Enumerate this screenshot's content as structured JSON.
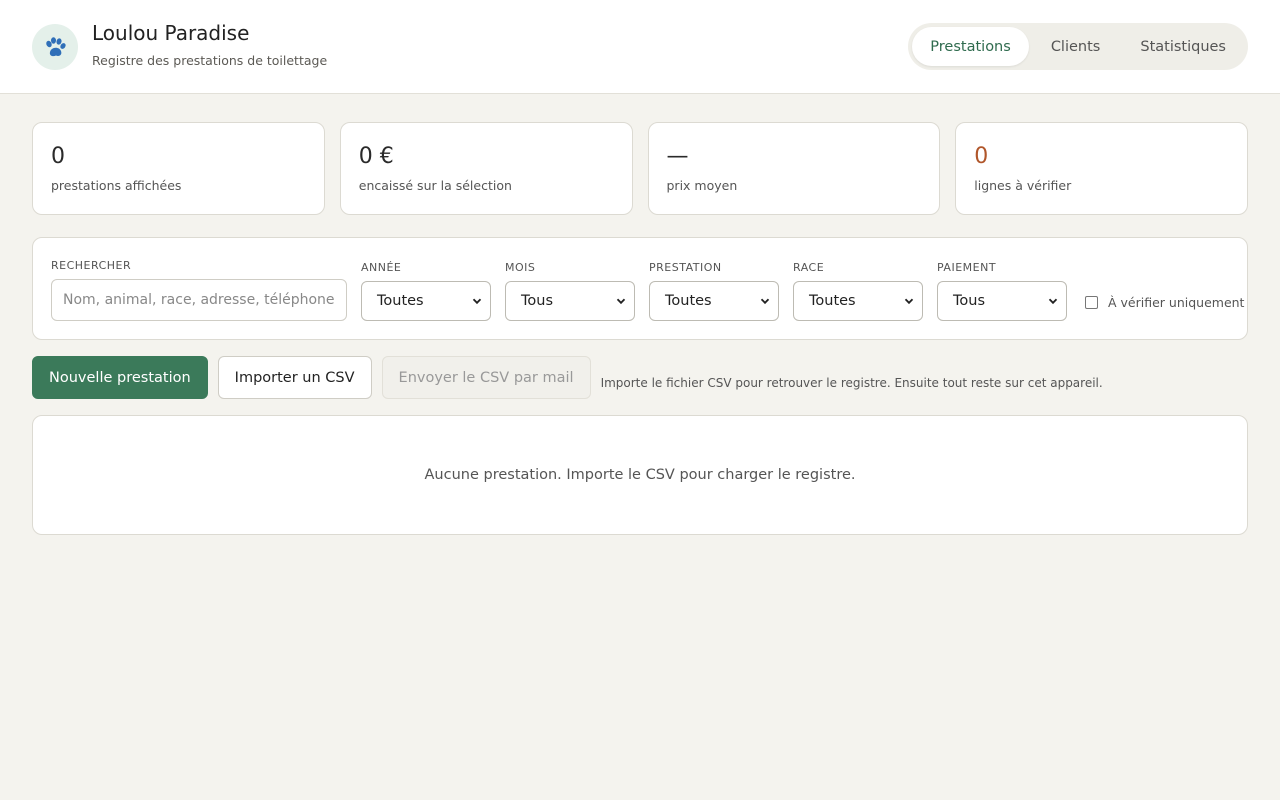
{
  "header": {
    "title": "Loulou Paradise",
    "subtitle": "Registre des prestations de toilettage",
    "logo_icon": "paw-icon",
    "tabs": [
      {
        "label": "Prestations",
        "active": true
      },
      {
        "label": "Clients",
        "active": false
      },
      {
        "label": "Statistiques",
        "active": false
      }
    ]
  },
  "stats": [
    {
      "value": "0",
      "label": "prestations affichées"
    },
    {
      "value": "0 €",
      "label": "encaissé sur la sélection"
    },
    {
      "value": "—",
      "label": "prix moyen"
    },
    {
      "value": "0",
      "label": "lignes à vérifier"
    }
  ],
  "filters": {
    "search": {
      "label": "RECHERCHER",
      "placeholder": "Nom, animal, race, adresse, téléphone",
      "value": ""
    },
    "annee": {
      "label": "ANNÉE",
      "value": "Toutes"
    },
    "mois": {
      "label": "MOIS",
      "value": "Tous"
    },
    "prestation": {
      "label": "PRESTATION",
      "value": "Toutes"
    },
    "race": {
      "label": "RACE",
      "value": "Toutes"
    },
    "paiement": {
      "label": "PAIEMENT",
      "value": "Tous"
    },
    "verify_only": {
      "label": "À vérifier uniquement",
      "checked": false
    }
  },
  "actions": {
    "new_label": "Nouvelle prestation",
    "import_label": "Importer un CSV",
    "email_label": "Envoyer le CSV par mail",
    "hint": "Importe le fichier CSV pour retrouver le registre. Ensuite tout reste sur cet appareil."
  },
  "empty_state": "Aucune prestation. Importe le CSV pour charger le registre.",
  "colors": {
    "accent": "#3b7a5a",
    "warning": "#b0562a",
    "background": "#f4f3ee"
  }
}
